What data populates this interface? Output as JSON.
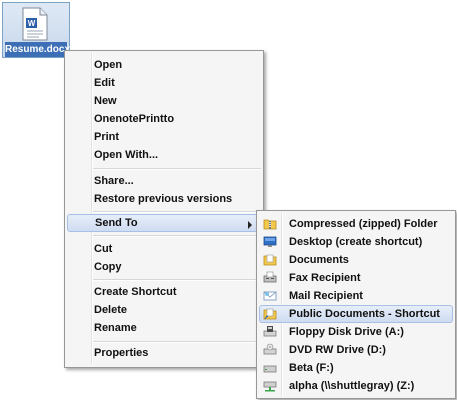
{
  "file": {
    "name": "Resume.docx"
  },
  "context_menu": {
    "items": [
      {
        "label": "Open"
      },
      {
        "label": "Edit"
      },
      {
        "label": "New"
      },
      {
        "label": "OnenotePrintto"
      },
      {
        "label": "Print"
      },
      {
        "label": "Open With..."
      },
      {
        "label": "Share..."
      },
      {
        "label": "Restore previous versions"
      },
      {
        "label": "Send To",
        "has_submenu": true,
        "highlighted": true
      },
      {
        "label": "Cut"
      },
      {
        "label": "Copy"
      },
      {
        "label": "Create Shortcut"
      },
      {
        "label": "Delete"
      },
      {
        "label": "Rename"
      },
      {
        "label": "Properties"
      }
    ]
  },
  "send_to_menu": {
    "items": [
      {
        "label": "Compressed (zipped) Folder",
        "icon": "zip-folder-icon"
      },
      {
        "label": "Desktop (create shortcut)",
        "icon": "desktop-icon"
      },
      {
        "label": "Documents",
        "icon": "documents-folder-icon"
      },
      {
        "label": "Fax Recipient",
        "icon": "fax-icon"
      },
      {
        "label": "Mail Recipient",
        "icon": "mail-icon"
      },
      {
        "label": "Public Documents - Shortcut",
        "icon": "public-folder-icon",
        "highlighted": true
      },
      {
        "label": "Floppy Disk Drive (A:)",
        "icon": "floppy-drive-icon"
      },
      {
        "label": "DVD RW Drive (D:)",
        "icon": "dvd-drive-icon"
      },
      {
        "label": "Beta (F:)",
        "icon": "hard-drive-icon"
      },
      {
        "label": "alpha (\\\\shuttlegray) (Z:)",
        "icon": "network-drive-icon"
      }
    ]
  },
  "colors": {
    "menu_background": "#f5f5f5",
    "highlight": "#cfdcf1",
    "file_label_background": "#3d6fb6"
  }
}
